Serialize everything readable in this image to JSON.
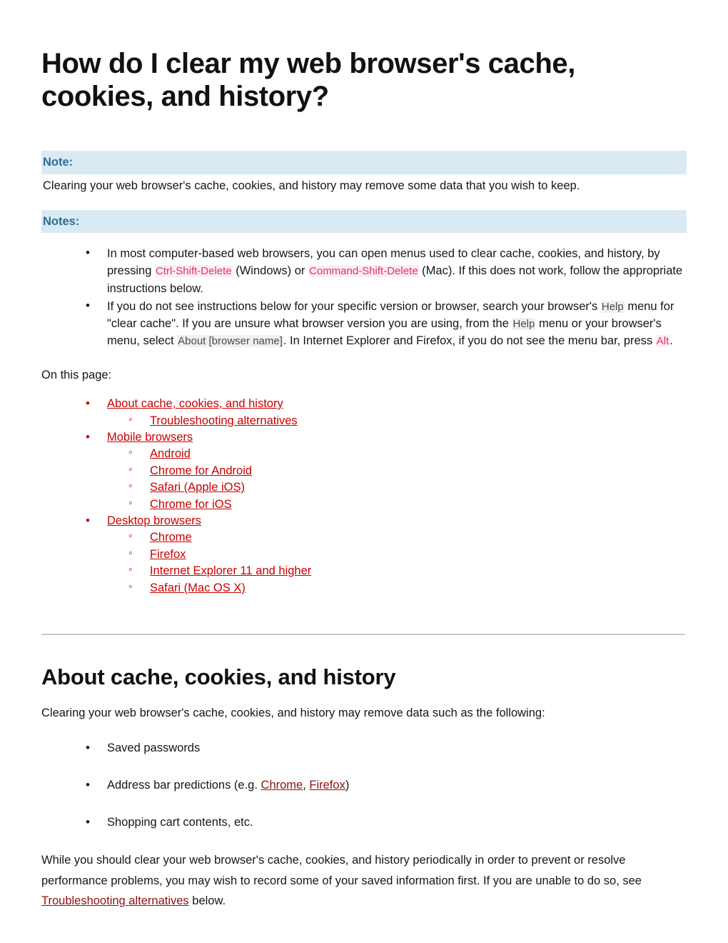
{
  "document": {
    "title": "How do I clear my web browser's cache, cookies, and history?"
  },
  "note": {
    "heading": "Note:",
    "body": "Clearing your web browser's cache, cookies, and history may remove some data that you wish to keep."
  },
  "notes": {
    "heading": "Notes:",
    "items": [
      {
        "seg1": "In most computer-based web browsers, you can open menus used to clear cache, cookies, and history, by pressing ",
        "kbd1": "Ctrl-Shift-Delete",
        "seg2": " (Windows) or ",
        "kbd2": "Command-Shift-Delete",
        "seg3": " (Mac). If this does not work, follow the appropriate instructions below."
      },
      {
        "seg1": "If you do not see instructions below for your specific version or browser, search your browser's ",
        "ui1": "Help",
        "seg2": " menu for \"clear cache\". If you are unsure what browser version you are using, from the ",
        "ui2": "Help",
        "seg3": " menu or your browser's menu, select ",
        "ui3": "About [browser name]",
        "seg4": ". In Internet Explorer and Firefox, if you do not see the menu bar, press ",
        "kbd1": "Alt",
        "seg5": "."
      }
    ]
  },
  "toc": {
    "label": "On this page:",
    "groups": [
      {
        "label": "About cache, cookies, and history",
        "children": [
          "Troubleshooting alternatives"
        ]
      },
      {
        "label": "Mobile browsers",
        "children": [
          "Android",
          "Chrome for Android",
          "Safari (Apple iOS)",
          "Chrome for iOS"
        ]
      },
      {
        "label": "Desktop browsers",
        "children": [
          "Chrome",
          "Firefox",
          "Internet Explorer 11 and higher",
          "Safari (Mac OS X)"
        ]
      }
    ]
  },
  "section_about": {
    "title": "About cache, cookies, and history",
    "intro": "Clearing your web browser's cache, cookies, and history may remove data such as the following:",
    "bullets": [
      {
        "text": "Saved passwords"
      },
      {
        "pre": "Address bar predictions (e.g. ",
        "link1": "Chrome",
        "mid": ", ",
        "link2": "Firefox",
        "post": ")"
      },
      {
        "text": "Shopping cart contents, etc."
      }
    ],
    "closing": {
      "pre": "While you should clear your web browser's cache, cookies, and history periodically in order to prevent or resolve performance problems, you may wish to record some of your saved information first. If you are unable to do so, see ",
      "link": "Troubleshooting alternatives",
      "post": " below."
    }
  },
  "colors": {
    "link_red": "#cc0000",
    "link_dark_red": "#8c1111",
    "note_bg": "#d9eaf3",
    "note_fg": "#2a6f96",
    "kbd_fg": "#e0325f",
    "kbd_bg": "#fdeef3",
    "ui_fg": "#4a4a4a",
    "ui_bg": "#f0f0f0"
  }
}
